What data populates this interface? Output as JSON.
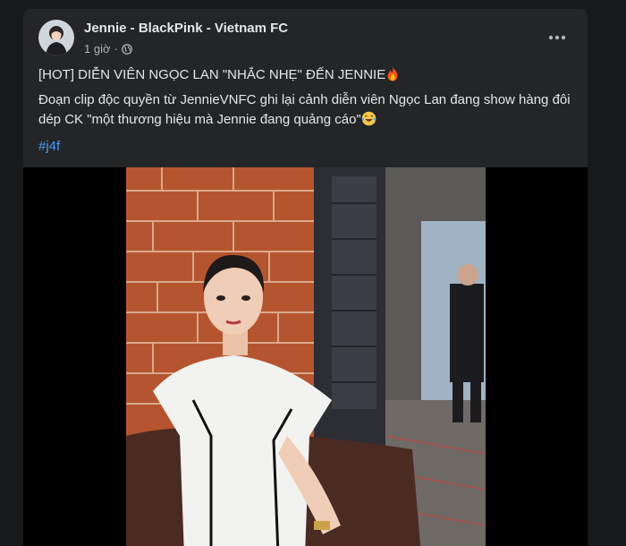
{
  "post": {
    "author": "Jennie - BlackPink - Vietnam FC",
    "time": "1 giờ",
    "separator": "·",
    "privacy_icon": "globe-icon",
    "more_icon": "more-options-icon",
    "title_line": "[HOT] DIỄN VIÊN NGỌC LAN \"NHẮC NHẸ\" ĐẾN JENNIE",
    "title_emoji": "fire-icon",
    "body_line": "Đoạn clip độc quyền từ JennieVNFC ghi lại cảnh diễn viên Ngọc Lan đang show hàng đôi dép CK \"một thương hiệu mà Jennie đang quảng cáo\"",
    "body_emoji": "tears-of-joy-icon",
    "hashtag": "#j4f"
  },
  "colors": {
    "card_bg": "#242526",
    "page_bg": "#18191a",
    "text": "#e4e6eb",
    "secondary_text": "#b0b3b8",
    "link": "#4599ff"
  }
}
